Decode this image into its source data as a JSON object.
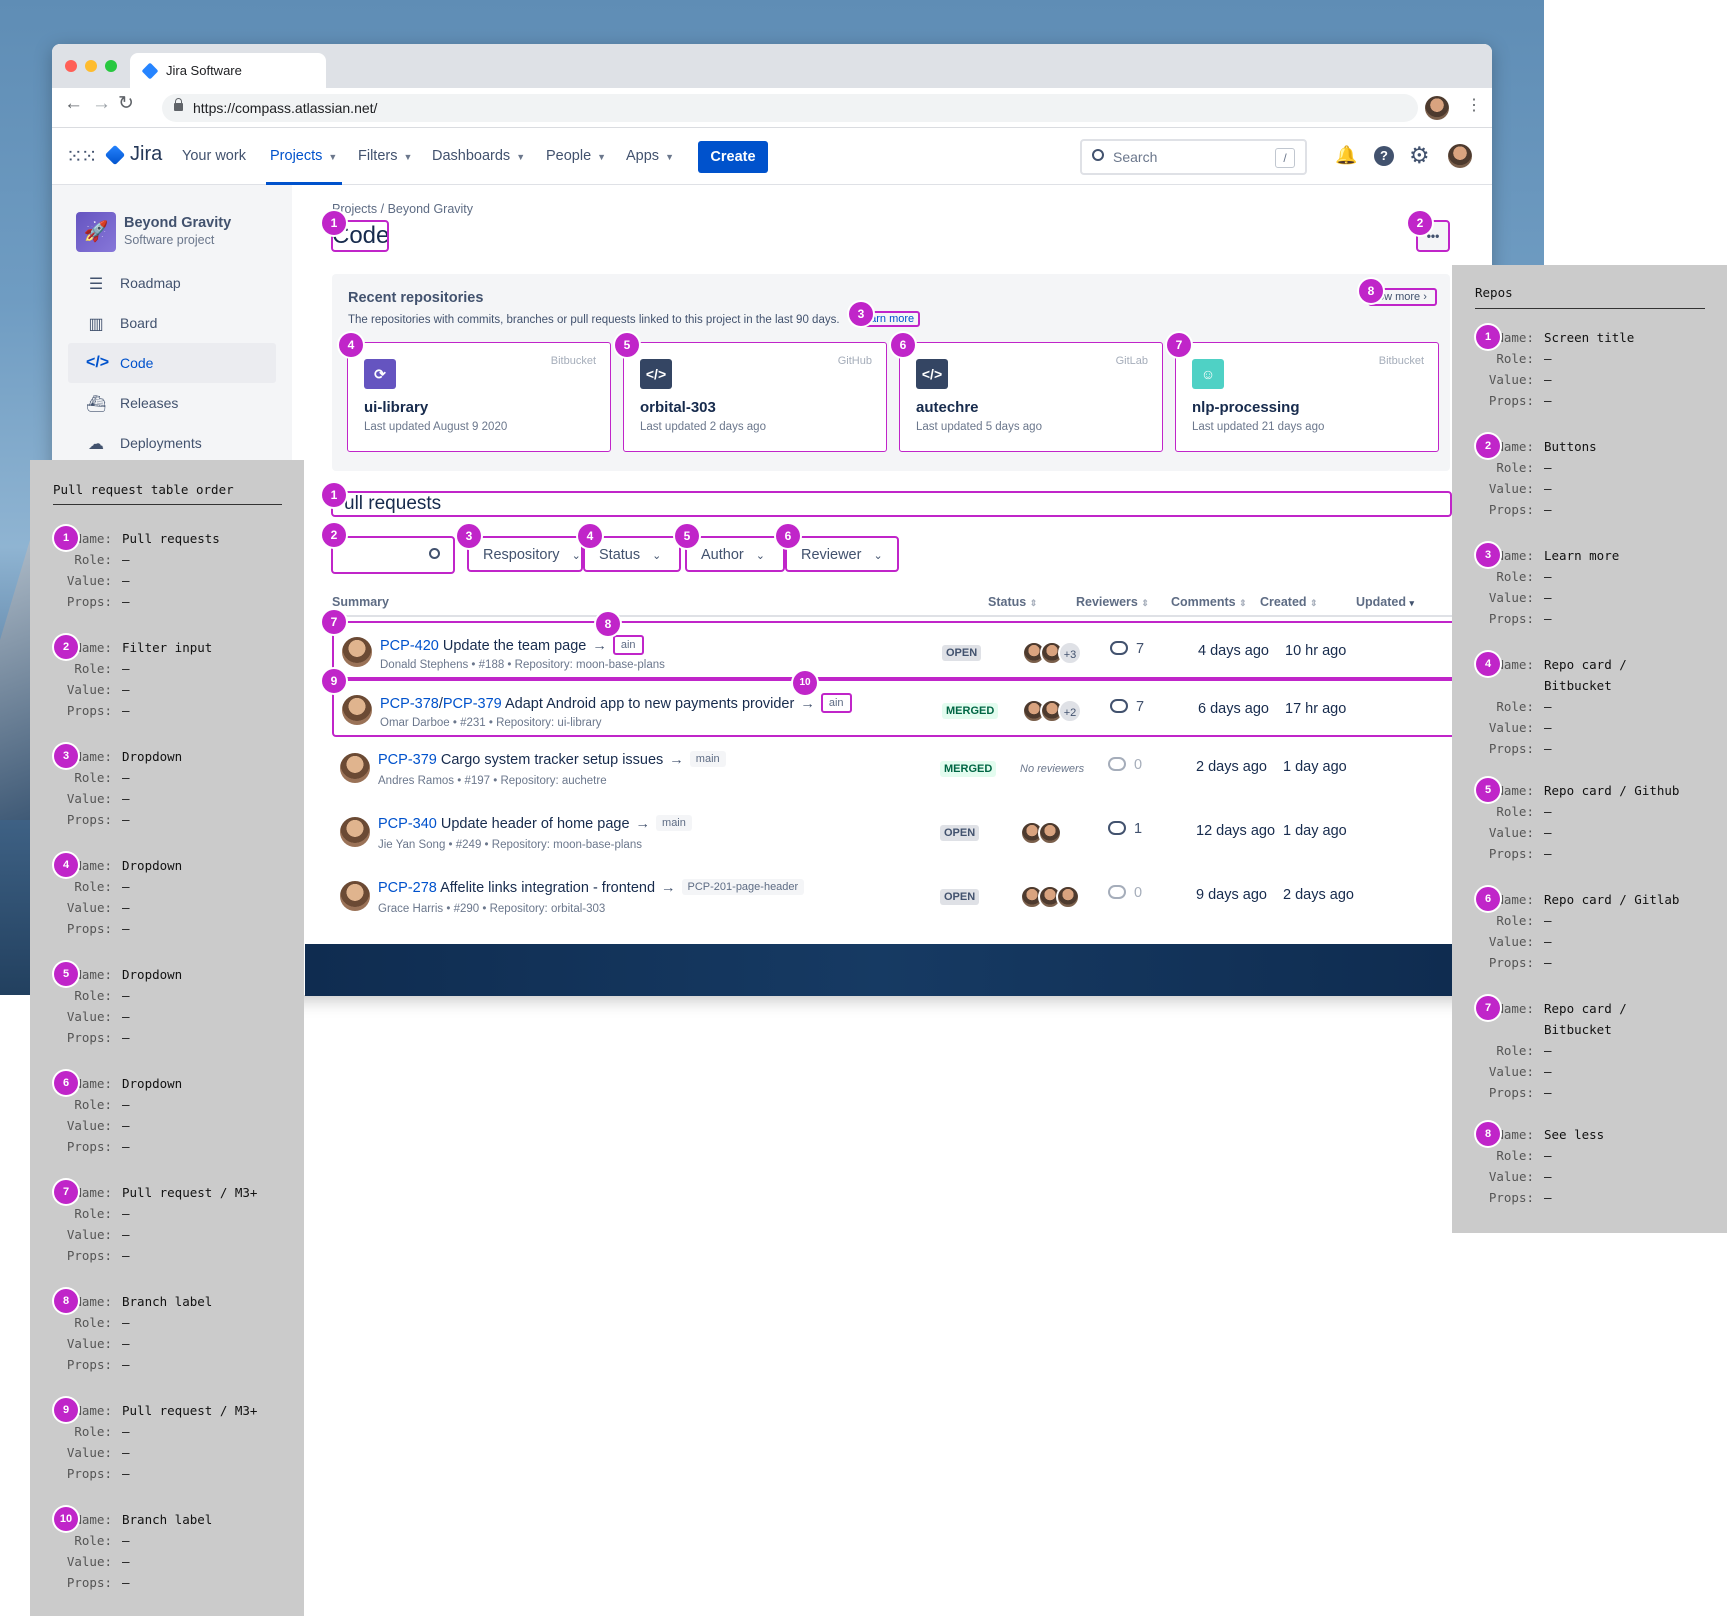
{
  "browser": {
    "tab_title": "Jira Software",
    "url": "https://compass.atlassian.net/"
  },
  "jira_nav": {
    "logo_text": "Jira",
    "your_work": "Your work",
    "projects": "Projects",
    "filters": "Filters",
    "dashboards": "Dashboards",
    "people": "People",
    "apps": "Apps",
    "create": "Create",
    "search_placeholder": "Search",
    "search_shortcut": "/"
  },
  "sidebar": {
    "project_name": "Beyond Gravity",
    "project_type": "Software project",
    "items": [
      {
        "label": "Roadmap",
        "icon": "roadmap-icon"
      },
      {
        "label": "Board",
        "icon": "board-icon"
      },
      {
        "label": "Code",
        "icon": "code-icon",
        "active": true
      },
      {
        "label": "Releases",
        "icon": "releases-icon"
      },
      {
        "label": "Deployments",
        "icon": "deployments-icon"
      }
    ]
  },
  "page": {
    "breadcrumb": "Projects / Beyond Gravity",
    "title": "Code",
    "more_button": "•••"
  },
  "recent_repos": {
    "heading": "Recent repositories",
    "description": "The repositories with commits, branches or pull requests linked to this project in the last 90 days.",
    "learn_more": "earn more",
    "show_more": "ow more",
    "repos": [
      {
        "name": "ui-library",
        "provider": "Bitbucket",
        "updated": "Last updated August 9 2020",
        "color": "#6554c0"
      },
      {
        "name": "orbital-303",
        "provider": "GitHub",
        "updated": "Last updated 2 days ago",
        "color": "#344563"
      },
      {
        "name": "autechre",
        "provider": "GitLab",
        "updated": "Last updated 5 days ago",
        "color": "#344563"
      },
      {
        "name": "nlp-processing",
        "provider": "Bitbucket",
        "updated": "Last updated 21 days ago",
        "color": "#4fd1c5"
      }
    ]
  },
  "pull_requests": {
    "heading": "ull requests",
    "filters": [
      "Respository",
      "Status",
      "Author",
      "Reviewer"
    ],
    "columns": {
      "summary": "Summary",
      "status": "Status",
      "reviewers": "Reviewers",
      "comments": "Comments",
      "created": "Created",
      "updated": "Updated"
    },
    "rows": [
      {
        "key": "PCP-420",
        "key2": "",
        "title": "Update the team page",
        "branch": "ain",
        "sub": "Donald Stephens • #188 • Repository: moon-base-plans",
        "status": "OPEN",
        "reviewers_extra": "+3",
        "comments": "7",
        "created": "4 days ago",
        "updated": "10 hr ago"
      },
      {
        "key": "PCP-378",
        "key2": "PCP-379",
        "title": "Adapt Android app to new payments provider",
        "branch": "ain",
        "sub": "Omar Darboe • #231 • Repository: ui-library",
        "status": "MERGED",
        "reviewers_extra": "+2",
        "comments": "7",
        "created": "6 days ago",
        "updated": "17 hr ago"
      },
      {
        "key": "PCP-379",
        "key2": "",
        "title": "Cargo system tracker setup issues",
        "branch": "main",
        "sub": "Andres Ramos • #197 • Repository: auchetre",
        "status": "MERGED",
        "reviewers_extra": "",
        "no_reviewers": "No reviewers",
        "comments": "0",
        "created": "2 days ago",
        "updated": "1 day ago"
      },
      {
        "key": "PCP-340",
        "key2": "",
        "title": "Update header of home page",
        "branch": "main",
        "sub": "Jie Yan Song • #249 • Repository: moon-base-plans",
        "status": "OPEN",
        "reviewers_extra": "",
        "comments": "1",
        "created": "12 days ago",
        "updated": "1 day ago"
      },
      {
        "key": "PCP-278",
        "key2": "",
        "title": "Affelite links integration - frontend",
        "branch": "PCP-201-page-header",
        "sub": "Grace Harris • #290 • Repository: orbital-303",
        "status": "OPEN",
        "reviewers_extra": "",
        "comments": "0",
        "created": "9 days ago",
        "updated": "2 days ago"
      }
    ]
  },
  "annotations": {
    "left_title": "Pull request table order",
    "right_title": "Repos",
    "labels": {
      "name": "Name:",
      "role": "Role:",
      "value": "Value:",
      "props": "Props:"
    },
    "dash": "–",
    "left": [
      {
        "n": "1",
        "name": "Pull requests"
      },
      {
        "n": "2",
        "name": "Filter input"
      },
      {
        "n": "3",
        "name": "Dropdown"
      },
      {
        "n": "4",
        "name": "Dropdown"
      },
      {
        "n": "5",
        "name": "Dropdown"
      },
      {
        "n": "6",
        "name": "Dropdown"
      },
      {
        "n": "7",
        "name": "Pull request / M3+"
      },
      {
        "n": "8",
        "name": "Branch label"
      },
      {
        "n": "9",
        "name": "Pull request / M3+"
      },
      {
        "n": "10",
        "name": "Branch label"
      }
    ],
    "right": [
      {
        "n": "1",
        "name": "Screen title"
      },
      {
        "n": "2",
        "name": "Buttons"
      },
      {
        "n": "3",
        "name": "Learn more"
      },
      {
        "n": "4",
        "name": "Repo card / Bitbucket"
      },
      {
        "n": "5",
        "name": "Repo card / Github"
      },
      {
        "n": "6",
        "name": "Repo card / Gitlab"
      },
      {
        "n": "7",
        "name": "Repo card / Bitbucket"
      },
      {
        "n": "8",
        "name": "See less"
      }
    ]
  }
}
